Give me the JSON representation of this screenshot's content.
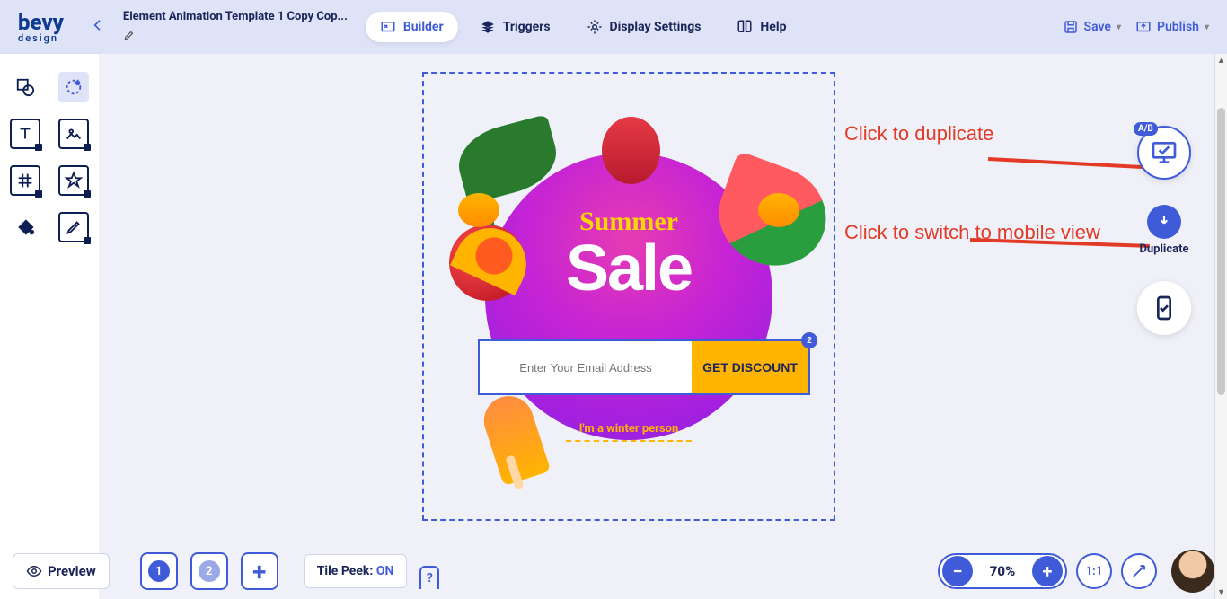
{
  "brand": {
    "name": "bevy",
    "tag": "design"
  },
  "header": {
    "title": "Element Animation Template 1 Copy Cop...",
    "tabs": {
      "builder": "Builder",
      "triggers": "Triggers",
      "display": "Display Settings",
      "help": "Help"
    },
    "save": "Save",
    "publish": "Publish"
  },
  "annotations": {
    "dup": "Click to duplicate",
    "mobile": "Click to switch to mobile view"
  },
  "right_buttons": {
    "ab": "A/B",
    "duplicate": "Duplicate"
  },
  "popup": {
    "title": "Summer",
    "big": "Sale",
    "email_placeholder": "Enter Your Email Address",
    "cta": "GET DISCOUNT",
    "cta_badge": "2",
    "winter": "I'm a winter person"
  },
  "bottom": {
    "preview": "Preview",
    "pages": [
      "1",
      "2"
    ],
    "tile_label": "Tile Peek: ",
    "tile_state": "ON",
    "help": "?",
    "zoom": "70%",
    "fit": "1:1"
  }
}
